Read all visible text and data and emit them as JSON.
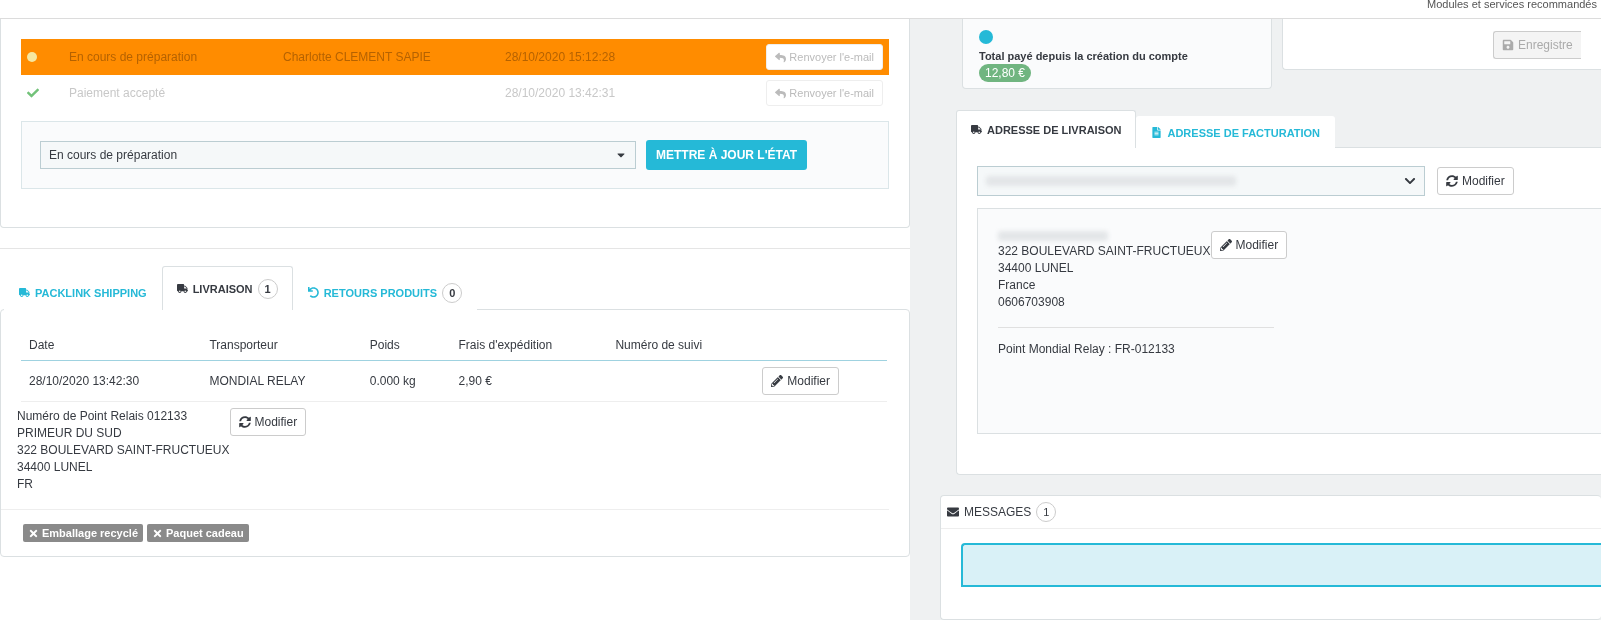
{
  "header": {
    "link": "Modules et services recommandés"
  },
  "history": {
    "rows": [
      {
        "status": "En cours de préparation",
        "employee": "Charlotte CLEMENT SAPIE",
        "date": "28/10/2020 15:12:28",
        "button": "Renvoyer l'e-mail",
        "color": "#ff8c00",
        "current": true
      },
      {
        "status": "Paiement accepté",
        "date": "28/10/2020 13:42:31",
        "button": "Renvoyer l'e-mail",
        "color": "#ffffff",
        "current": false
      }
    ],
    "state_select": {
      "value": "En cours de préparation"
    },
    "update_button": "METTRE À JOUR L'ÉTAT"
  },
  "shipping_tabs": [
    {
      "label": "PACKLINK SHIPPING",
      "selected": false
    },
    {
      "label": "LIVRAISON",
      "count": "1",
      "selected": true
    },
    {
      "label": "RETOURS PRODUITS",
      "count": "0",
      "selected": false
    }
  ],
  "shipping_table": {
    "columns": [
      "Date",
      "Transporteur",
      "Poids",
      "Frais d'expédition",
      "Numéro de suivi"
    ],
    "rows": [
      {
        "cells": [
          "28/10/2020 13:42:30",
          "MONDIAL RELAY",
          "0.000 kg",
          "2,90 €",
          ""
        ],
        "button": "Modifier"
      }
    ]
  },
  "relay": {
    "lines": [
      "Numéro de Point Relais 012133",
      "PRIMEUR DU SUD",
      "322 BOULEVARD SAINT-FRUCTUEUX",
      "34400 LUNEL",
      "FR"
    ],
    "button": "Modifier"
  },
  "tags": [
    "Emballage recyclé",
    "Paquet cadeau"
  ],
  "customer": {
    "total_label": "Total payé depuis la création du compte",
    "total_value": "12,80 €",
    "save_button": "Enregistre"
  },
  "address_tabs": [
    {
      "label": "ADRESSE DE LIVRAISON",
      "selected": true
    },
    {
      "label": "ADRESSE DE FACTURATION",
      "selected": false
    }
  ],
  "address": {
    "select_button": "Modifier",
    "lines": [
      "322 BOULEVARD SAINT-FRUCTUEUX",
      "34400 LUNEL",
      "France",
      "0606703908"
    ],
    "edit_button": "Modifier",
    "relay_point": "Point Mondial Relay : FR-012133"
  },
  "messages": {
    "title": "MESSAGES",
    "count": "1"
  }
}
